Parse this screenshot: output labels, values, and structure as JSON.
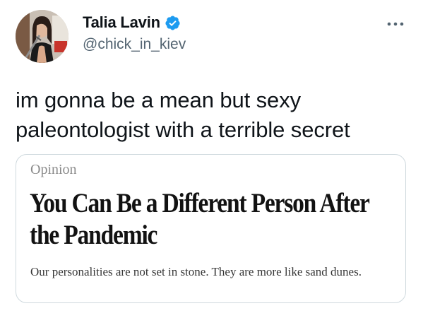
{
  "author": {
    "display_name": "Talia Lavin",
    "handle": "@chick_in_kiev",
    "verified": true,
    "avatar_icon": "profile-photo"
  },
  "tweet": {
    "text": "im gonna be a mean but sexy paleontologist with a terrible secret"
  },
  "card": {
    "kicker": "Opinion",
    "title": "You Can Be a Different Person After the Pandemic",
    "summary": "Our personalities are not set in stone. They are more like sand dunes."
  },
  "icons": {
    "verified": "verified-badge-icon",
    "more": "more-options-icon"
  },
  "colors": {
    "verified_blue": "#1d9bf0",
    "text_primary": "#0f1419",
    "text_secondary": "#536471",
    "card_border": "#cfd9de"
  }
}
